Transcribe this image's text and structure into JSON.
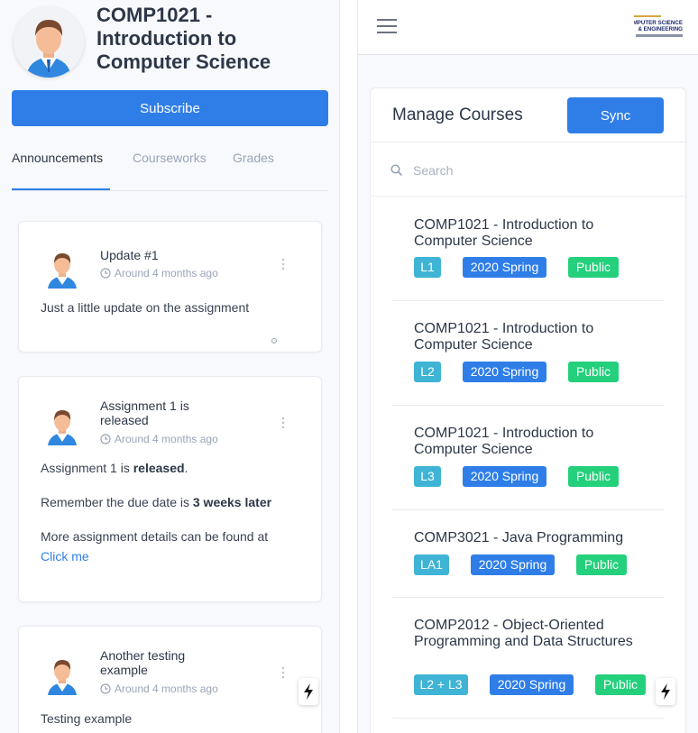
{
  "left": {
    "course_title": "COMP1021 - Introduction to Computer Science",
    "subscribe_label": "Subscribe",
    "tabs": [
      {
        "label": "Announcements"
      },
      {
        "label": "Courseworks"
      },
      {
        "label": "Grades"
      }
    ],
    "announcements": [
      {
        "title": "Update #1",
        "time": "Around 4 months ago",
        "body": "Just a little update on the assignment"
      },
      {
        "title": "Assignment 1 is released",
        "time": "Around 4 months ago",
        "line1_pre": "Assignment 1 is ",
        "line1_bold": "released",
        "line1_post": ".",
        "line2_pre": "Remember the due date is ",
        "line2_bold": "3 weeks later",
        "line3": "More assignment details can be found at",
        "link": "Click me"
      },
      {
        "title": "Another testing example",
        "time": "Around 4 months ago",
        "body": "Testing example"
      }
    ]
  },
  "right": {
    "logo_text": [
      "COMPUTER SCIENCE",
      "& ENGINEERING"
    ],
    "panel_title": "Manage Courses",
    "sync_label": "Sync",
    "search_placeholder": "Search",
    "courses": [
      {
        "name": "COMP1021 - Introduction to Computer Science",
        "section": "L1",
        "term": "2020 Spring",
        "visibility": "Public"
      },
      {
        "name": "COMP1021 - Introduction to Computer Science",
        "section": "L2",
        "term": "2020 Spring",
        "visibility": "Public"
      },
      {
        "name": "COMP1021 - Introduction to Computer Science",
        "section": "L3",
        "term": "2020 Spring",
        "visibility": "Public"
      },
      {
        "name": "COMP3021 - Java Programming",
        "section": "LA1",
        "term": "2020 Spring",
        "visibility": "Public"
      },
      {
        "name": "COMP2012 - Object-Oriented Programming and Data Structures",
        "section": "L2 + L3",
        "term": "2020 Spring",
        "visibility": "Public"
      }
    ]
  },
  "colors": {
    "primary": "#2f7ee8",
    "section_badge": "#3fb4d4",
    "public_badge": "#25d07c"
  }
}
